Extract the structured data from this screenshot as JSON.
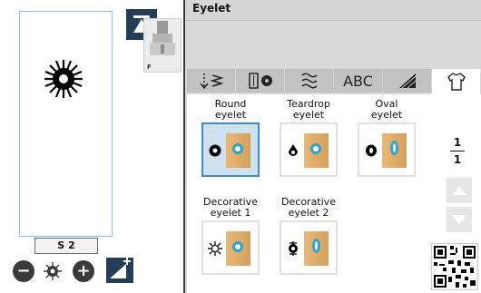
{
  "left_panel": {
    "size_label": "S 2",
    "presser_foot_label": "F",
    "minus_label": "−",
    "plus_label": "+"
  },
  "header": {
    "title": "Eyelet"
  },
  "tabs": [
    {
      "label": "↓≤",
      "icon": "stitch-utility-icon"
    },
    {
      "label": "▯●",
      "icon": "buttonhole-icon"
    },
    {
      "label": "≈",
      "icon": "decorative-stitch-icon"
    },
    {
      "label": "ABC",
      "icon": "character-icon"
    },
    {
      "label": "◢",
      "icon": "satin-icon"
    },
    {
      "label": "⛸",
      "icon": "garment-icon"
    }
  ],
  "active_tab": 5,
  "stitches": [
    {
      "label_1": "Round",
      "label_2": "eyelet",
      "selected": true
    },
    {
      "label_1": "Teardrop",
      "label_2": "eyelet",
      "selected": false
    },
    {
      "label_1": "Oval",
      "label_2": "eyelet",
      "selected": false
    },
    {
      "label_1": "Decorative",
      "label_2": "eyelet 1",
      "selected": false
    },
    {
      "label_1": "Decorative",
      "label_2": "eyelet 2",
      "selected": false
    }
  ],
  "pager": {
    "current": "1",
    "total": "1"
  },
  "colors": {
    "accent": "#3d8ec7",
    "fabric": "#d4a15c",
    "eyelet": "#2fa3d2",
    "dark_button": "#243e57"
  }
}
